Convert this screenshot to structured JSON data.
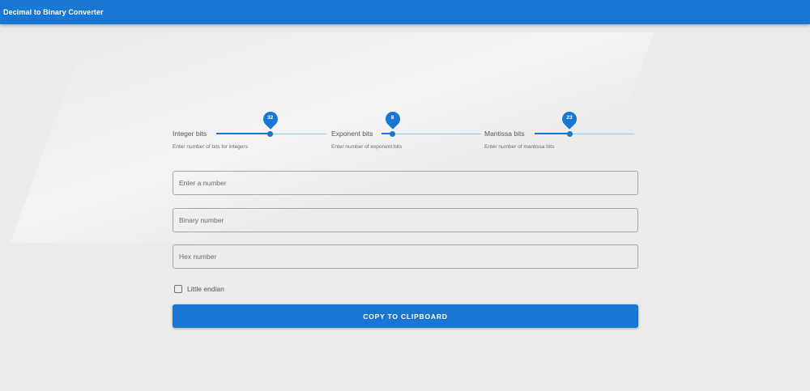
{
  "appbar": {
    "title": "Decimal to Binary Converter"
  },
  "sliders": [
    {
      "label": "Integer bits",
      "value": "32",
      "fill_fraction": 0.49,
      "helper": "Enter number of bits for integers"
    },
    {
      "label": "Exponent bits",
      "value": "8",
      "fill_fraction": 0.11,
      "helper": "Enter number of exponent bits"
    },
    {
      "label": "Mantissa bits",
      "value": "23",
      "fill_fraction": 0.35,
      "helper": "Enter number of mantissa bits"
    }
  ],
  "fields": {
    "number": {
      "placeholder": "Enter a number",
      "value": ""
    },
    "binary": {
      "placeholder": "Binary number",
      "value": ""
    },
    "hex": {
      "placeholder": "Hex number",
      "value": ""
    }
  },
  "checkbox": {
    "label": "Little endian",
    "checked": false
  },
  "button": {
    "label": "COPY TO CLIPBOARD"
  },
  "colors": {
    "primary": "#1976d2",
    "track": "#90caf9",
    "background": "#ececec"
  }
}
